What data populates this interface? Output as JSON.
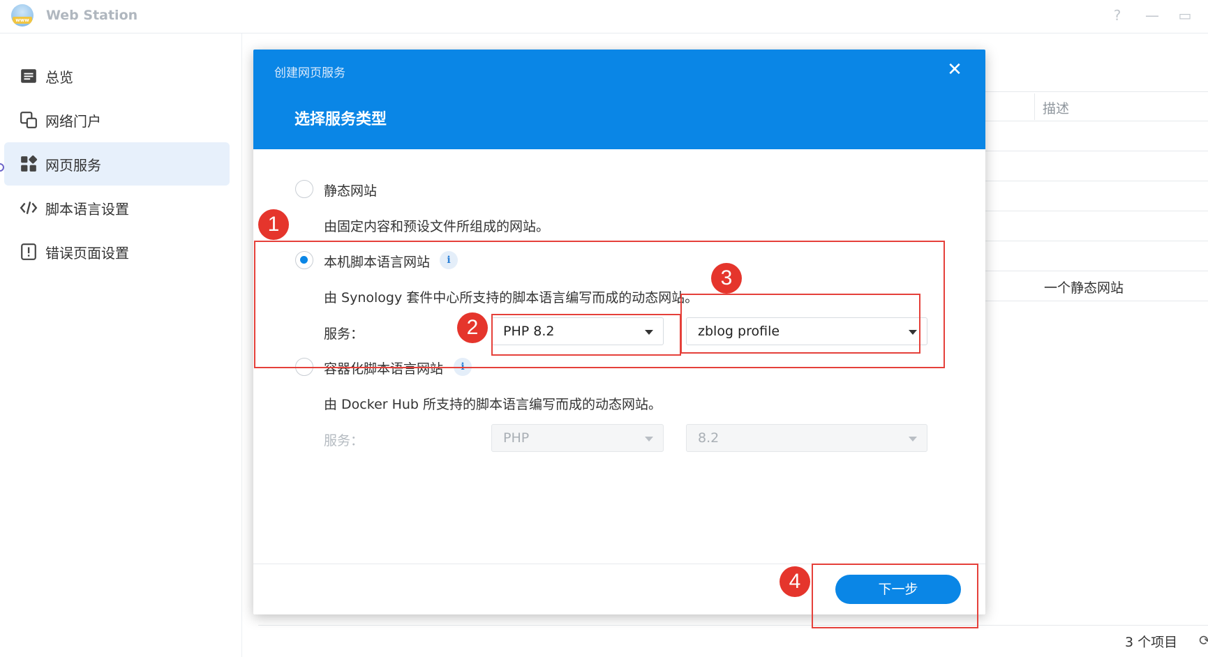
{
  "app": {
    "title": "Web Station",
    "help": "?",
    "minimize": "—",
    "maximize": "▭"
  },
  "sidebar": {
    "items": [
      {
        "label": "总览",
        "icon": "overview-icon"
      },
      {
        "label": "网络门户",
        "icon": "portal-icon"
      },
      {
        "label": "网页服务",
        "icon": "web-service-icon",
        "active": true
      },
      {
        "label": "脚本语言设置",
        "icon": "code-icon"
      },
      {
        "label": "错误页面设置",
        "icon": "error-page-icon"
      }
    ]
  },
  "background_list": {
    "column_header": "描述",
    "row_description": "一个静态网站",
    "item_count": "3 个项目"
  },
  "dialog": {
    "top_title": "创建网页服务",
    "step_title": "选择服务类型",
    "close": "✕",
    "options": [
      {
        "label": "静态网站",
        "description": "由固定内容和预设文件所组成的网站。",
        "selected": false
      },
      {
        "label": "本机脚本语言网站",
        "description": "由 Synology 套件中心所支持的脚本语言编写而成的动态网站。",
        "selected": true,
        "service_label": "服务：",
        "service": "PHP 8.2",
        "profile": "zblog profile"
      },
      {
        "label": "容器化脚本语言网站",
        "description": "由 Docker Hub 所支持的脚本语言编写而成的动态网站。",
        "selected": false,
        "service_label": "服务：",
        "service": "PHP",
        "version": "8.2"
      }
    ],
    "next_button": "下一步"
  },
  "annotations": [
    "1",
    "2",
    "3",
    "4"
  ],
  "colors": {
    "primary": "#0a86e6",
    "annotation": "#e5403a"
  }
}
